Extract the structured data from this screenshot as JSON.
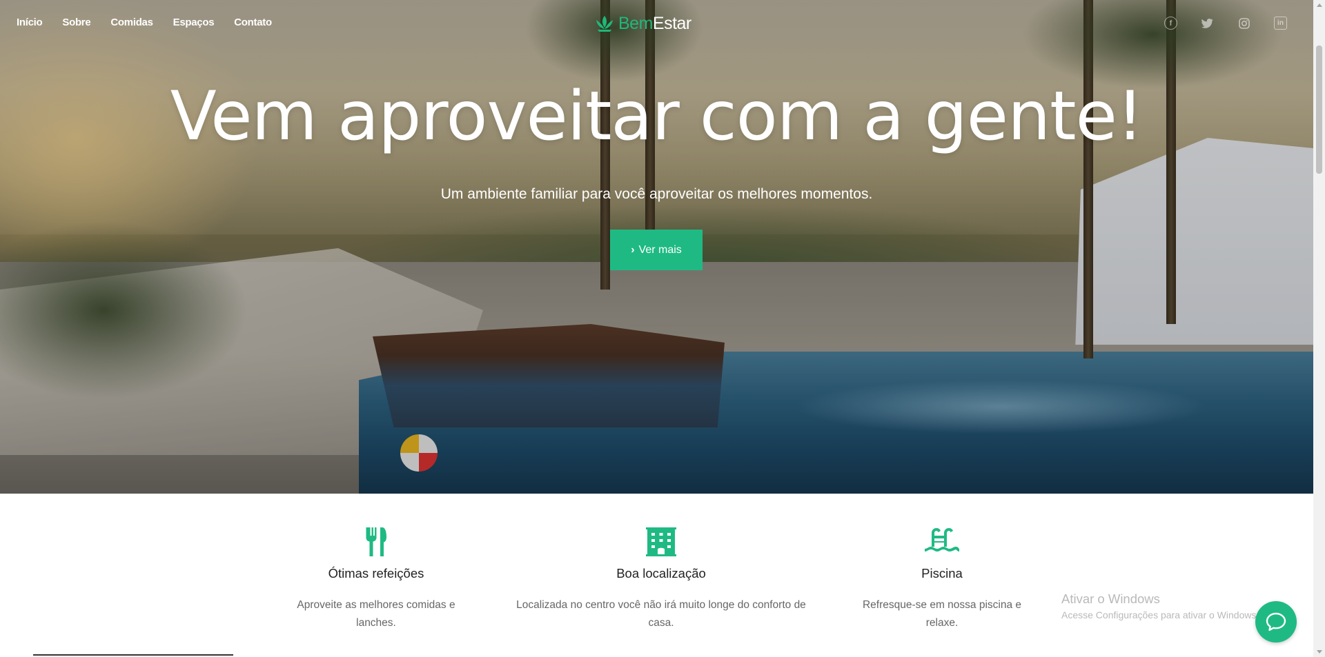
{
  "nav": {
    "links": [
      "Início",
      "Sobre",
      "Comidas",
      "Espaços",
      "Contato"
    ]
  },
  "logo": {
    "part1": "Bem",
    "part2": "Estar",
    "icon": "lotus-icon"
  },
  "social": {
    "icons": [
      "facebook-icon",
      "twitter-icon",
      "instagram-icon",
      "linkedin-icon"
    ]
  },
  "hero": {
    "headline": "Vem aproveitar com a gente!",
    "subtitle": "Um ambiente familiar para você aproveitar os melhores momentos.",
    "cta_label": "Ver mais",
    "cta_icon": "chevron-right-icon"
  },
  "features": [
    {
      "icon": "utensils-icon",
      "title": "Ótimas refeições",
      "text": "Aproveite as melhores comidas e lanches."
    },
    {
      "icon": "building-icon",
      "title": "Boa localização",
      "text": "Localizada no centro você não irá muito longe do conforto de casa."
    },
    {
      "icon": "swimming-pool-icon",
      "title": "Piscina",
      "text": "Refresque-se em nossa piscina e relaxe."
    }
  ],
  "watermark": {
    "title": "Ativar o Windows",
    "subtitle": "Acesse Configurações para ativar o Windows."
  },
  "colors": {
    "accent": "#1fba83",
    "text_dark": "#222222",
    "text_muted": "#666666"
  }
}
